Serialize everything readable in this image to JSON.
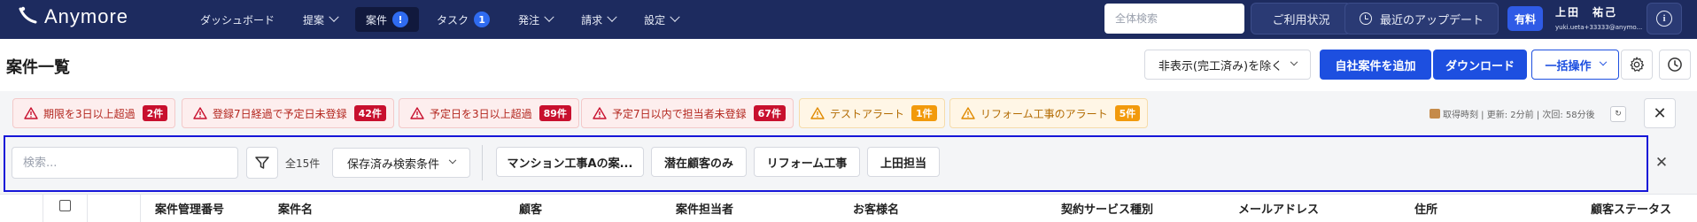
{
  "app": {
    "logo_text": "Anymore"
  },
  "nav": {
    "items": [
      {
        "label": "ダッシュボード",
        "has_dropdown": false,
        "active": false,
        "badge": ""
      },
      {
        "label": "提案",
        "has_dropdown": true,
        "active": false,
        "badge": ""
      },
      {
        "label": "案件",
        "has_dropdown": false,
        "active": true,
        "badge": "!"
      },
      {
        "label": "タスク",
        "has_dropdown": false,
        "active": false,
        "badge": "1"
      },
      {
        "label": "発注",
        "has_dropdown": true,
        "active": false,
        "badge": ""
      },
      {
        "label": "請求",
        "has_dropdown": true,
        "active": false,
        "badge": ""
      },
      {
        "label": "設定",
        "has_dropdown": true,
        "active": false,
        "badge": ""
      }
    ],
    "search_placeholder": "全体検索",
    "usage_label": "ご利用状況",
    "updates_label": "最近のアップデート",
    "plan_badge": "有料",
    "user_name": "上田　祐己",
    "user_email": "yuki.ueta+33333@anymo..."
  },
  "page": {
    "title": "案件一覧",
    "hidden_filter_label": "非表示(完工済み)を除く",
    "add_own_label": "自社案件を追加",
    "download_label": "ダウンロード",
    "bulk_label": "一括操作"
  },
  "alerts": [
    {
      "text": "期限を3日以上超過",
      "count": "2件",
      "level": "red"
    },
    {
      "text": "登録7日経過で予定日未登録",
      "count": "42件",
      "level": "red"
    },
    {
      "text": "予定日を3日以上超過",
      "count": "89件",
      "level": "red"
    },
    {
      "text": "予定7日以内で担当者未登録",
      "count": "67件",
      "level": "red"
    },
    {
      "text": "テストアラート",
      "count": "1件",
      "level": "orange"
    },
    {
      "text": "リフォーム工事のアラート",
      "count": "5件",
      "level": "orange"
    }
  ],
  "fetch_info": "取得時刻 | 更新: 2分前 | 次回: 58分後",
  "refresh_icon_glyph": "↻",
  "close_glyph": "✕",
  "filter": {
    "search_placeholder": "検索...",
    "total": "全15件",
    "saved_search_label": "保存済み検索条件",
    "chips": [
      "マンション工事Aの案...",
      "潜在顧客のみ",
      "リフォーム工事",
      "上田担当"
    ]
  },
  "table": {
    "columns": [
      "案件管理番号",
      "案件名",
      "顧客",
      "案件担当者",
      "お客様名",
      "契約サービス種別",
      "メールアドレス",
      "住所",
      "顧客ステータス"
    ]
  },
  "colors": {
    "nav_bg": "#1d2b5f",
    "primary": "#1d4fe0",
    "alert_red": "#c8102e",
    "alert_orange": "#f29a0c",
    "focus_frame": "#1616d8"
  },
  "icons": {
    "logo": "anymore-logo-icon",
    "updates": "clock-icon",
    "info": "info-icon",
    "settings": "gear-icon",
    "history": "history-icon",
    "filter": "filter-icon",
    "alert": "warning-triangle-icon",
    "fetch": "box-icon",
    "refresh": "refresh-icon",
    "close": "close-icon"
  }
}
